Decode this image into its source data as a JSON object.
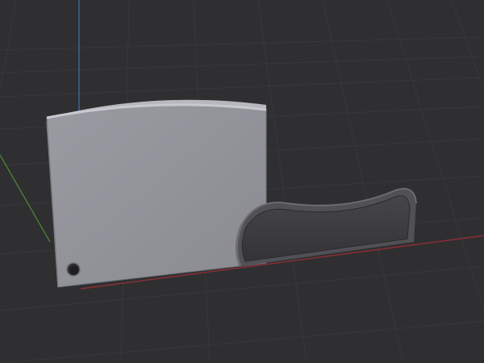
{
  "viewport": {
    "background": "#2f2f31",
    "grid_color": "#3a3a3c",
    "axis_x_color": "#8a2f35",
    "axis_y_color": "#5a8a3a",
    "axis_z_color": "#3f6fb0"
  },
  "model": {
    "blade_face_color": "#8f9097",
    "blade_top_color": "#b9bac0",
    "handle_dark_color": "#3b3b3e",
    "handle_edge_color": "#5b5b60"
  }
}
